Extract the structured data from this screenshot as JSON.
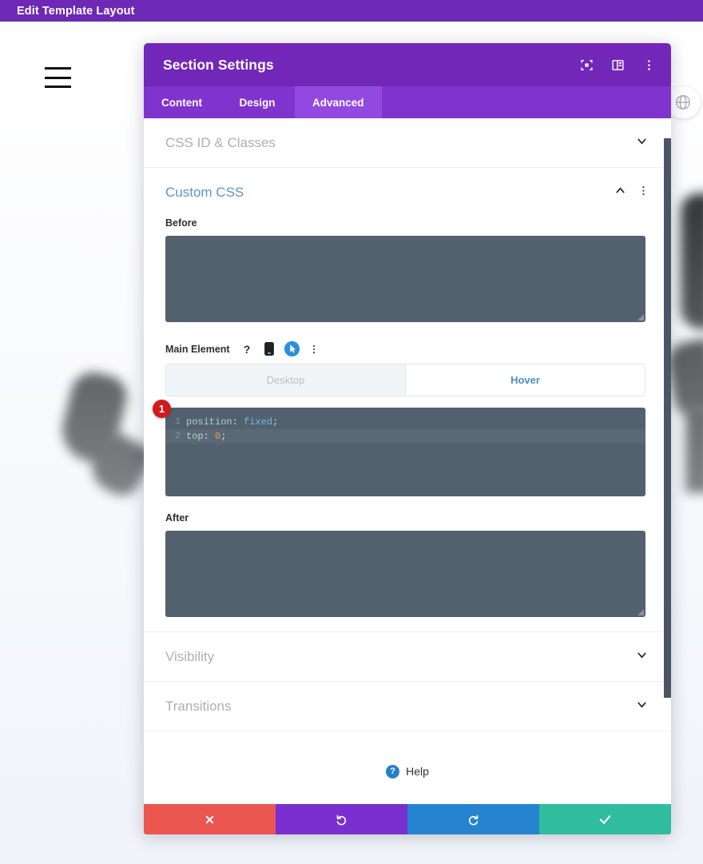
{
  "topbar": {
    "title": "Edit Template Layout"
  },
  "canvas": {
    "menu_icon": "hamburger-menu-icon",
    "globe_icon": "globe-icon"
  },
  "modal": {
    "title": "Section Settings",
    "header_icons": [
      {
        "name": "focus-target-icon",
        "label": "Focus"
      },
      {
        "name": "layout-panel-icon",
        "label": "Layout"
      },
      {
        "name": "more-options-icon",
        "label": "More"
      }
    ],
    "tabs": [
      {
        "label": "Content",
        "active": false
      },
      {
        "label": "Design",
        "active": false
      },
      {
        "label": "Advanced",
        "active": true
      }
    ],
    "sections": {
      "css_id_classes": {
        "label": "CSS ID & Classes",
        "expanded": false,
        "chevron": "chevron-down-icon"
      },
      "custom_css": {
        "label": "Custom CSS",
        "expanded": true,
        "chevron": "chevron-up-icon",
        "more_icon": "more-options-icon",
        "before": {
          "label": "Before",
          "value": "",
          "placeholder": ""
        },
        "main_element": {
          "label": "Main Element",
          "icons": [
            {
              "name": "help-icon",
              "glyph": "?"
            },
            {
              "name": "mobile-device-icon",
              "glyph": ""
            },
            {
              "name": "hover-cursor-icon",
              "glyph": ""
            },
            {
              "name": "more-options-icon",
              "glyph": ""
            }
          ],
          "state_tabs": [
            {
              "label": "Desktop",
              "active": false
            },
            {
              "label": "Hover",
              "active": true
            }
          ],
          "editor": {
            "badge": "1",
            "lines": [
              {
                "number": "1",
                "active": false,
                "property": "position",
                "colon": ":",
                "value": "fixed",
                "semicolon": ";",
                "value_type": "keyword"
              },
              {
                "number": "2",
                "active": true,
                "property": "top",
                "colon": ":",
                "value": "0",
                "semicolon": ";",
                "value_type": "number"
              }
            ]
          }
        },
        "after": {
          "label": "After",
          "value": "",
          "placeholder": ""
        }
      },
      "visibility": {
        "label": "Visibility",
        "expanded": false,
        "chevron": "chevron-down-icon"
      },
      "transitions": {
        "label": "Transitions",
        "expanded": false,
        "chevron": "chevron-down-icon"
      }
    },
    "help": {
      "label": "Help",
      "badge": "?"
    },
    "footer_buttons": [
      {
        "name": "cancel-button",
        "icon": "close-x-icon",
        "color": "#ec5650"
      },
      {
        "name": "undo-button",
        "icon": "undo-arrow-icon",
        "color": "#7a2fd0"
      },
      {
        "name": "redo-button",
        "icon": "redo-arrow-icon",
        "color": "#2683cf"
      },
      {
        "name": "save-button",
        "icon": "check-icon",
        "color": "#2fbd9e"
      }
    ]
  },
  "colors": {
    "topbar_purple": "#6d29b5",
    "modal_header_purple": "#7327b8",
    "tabbar_purple": "#8133cd",
    "tab_active_purple": "#9249e0",
    "editor_bg": "#53606e",
    "badge_red": "#cf1b20",
    "link_blue": "#5b97c4"
  }
}
